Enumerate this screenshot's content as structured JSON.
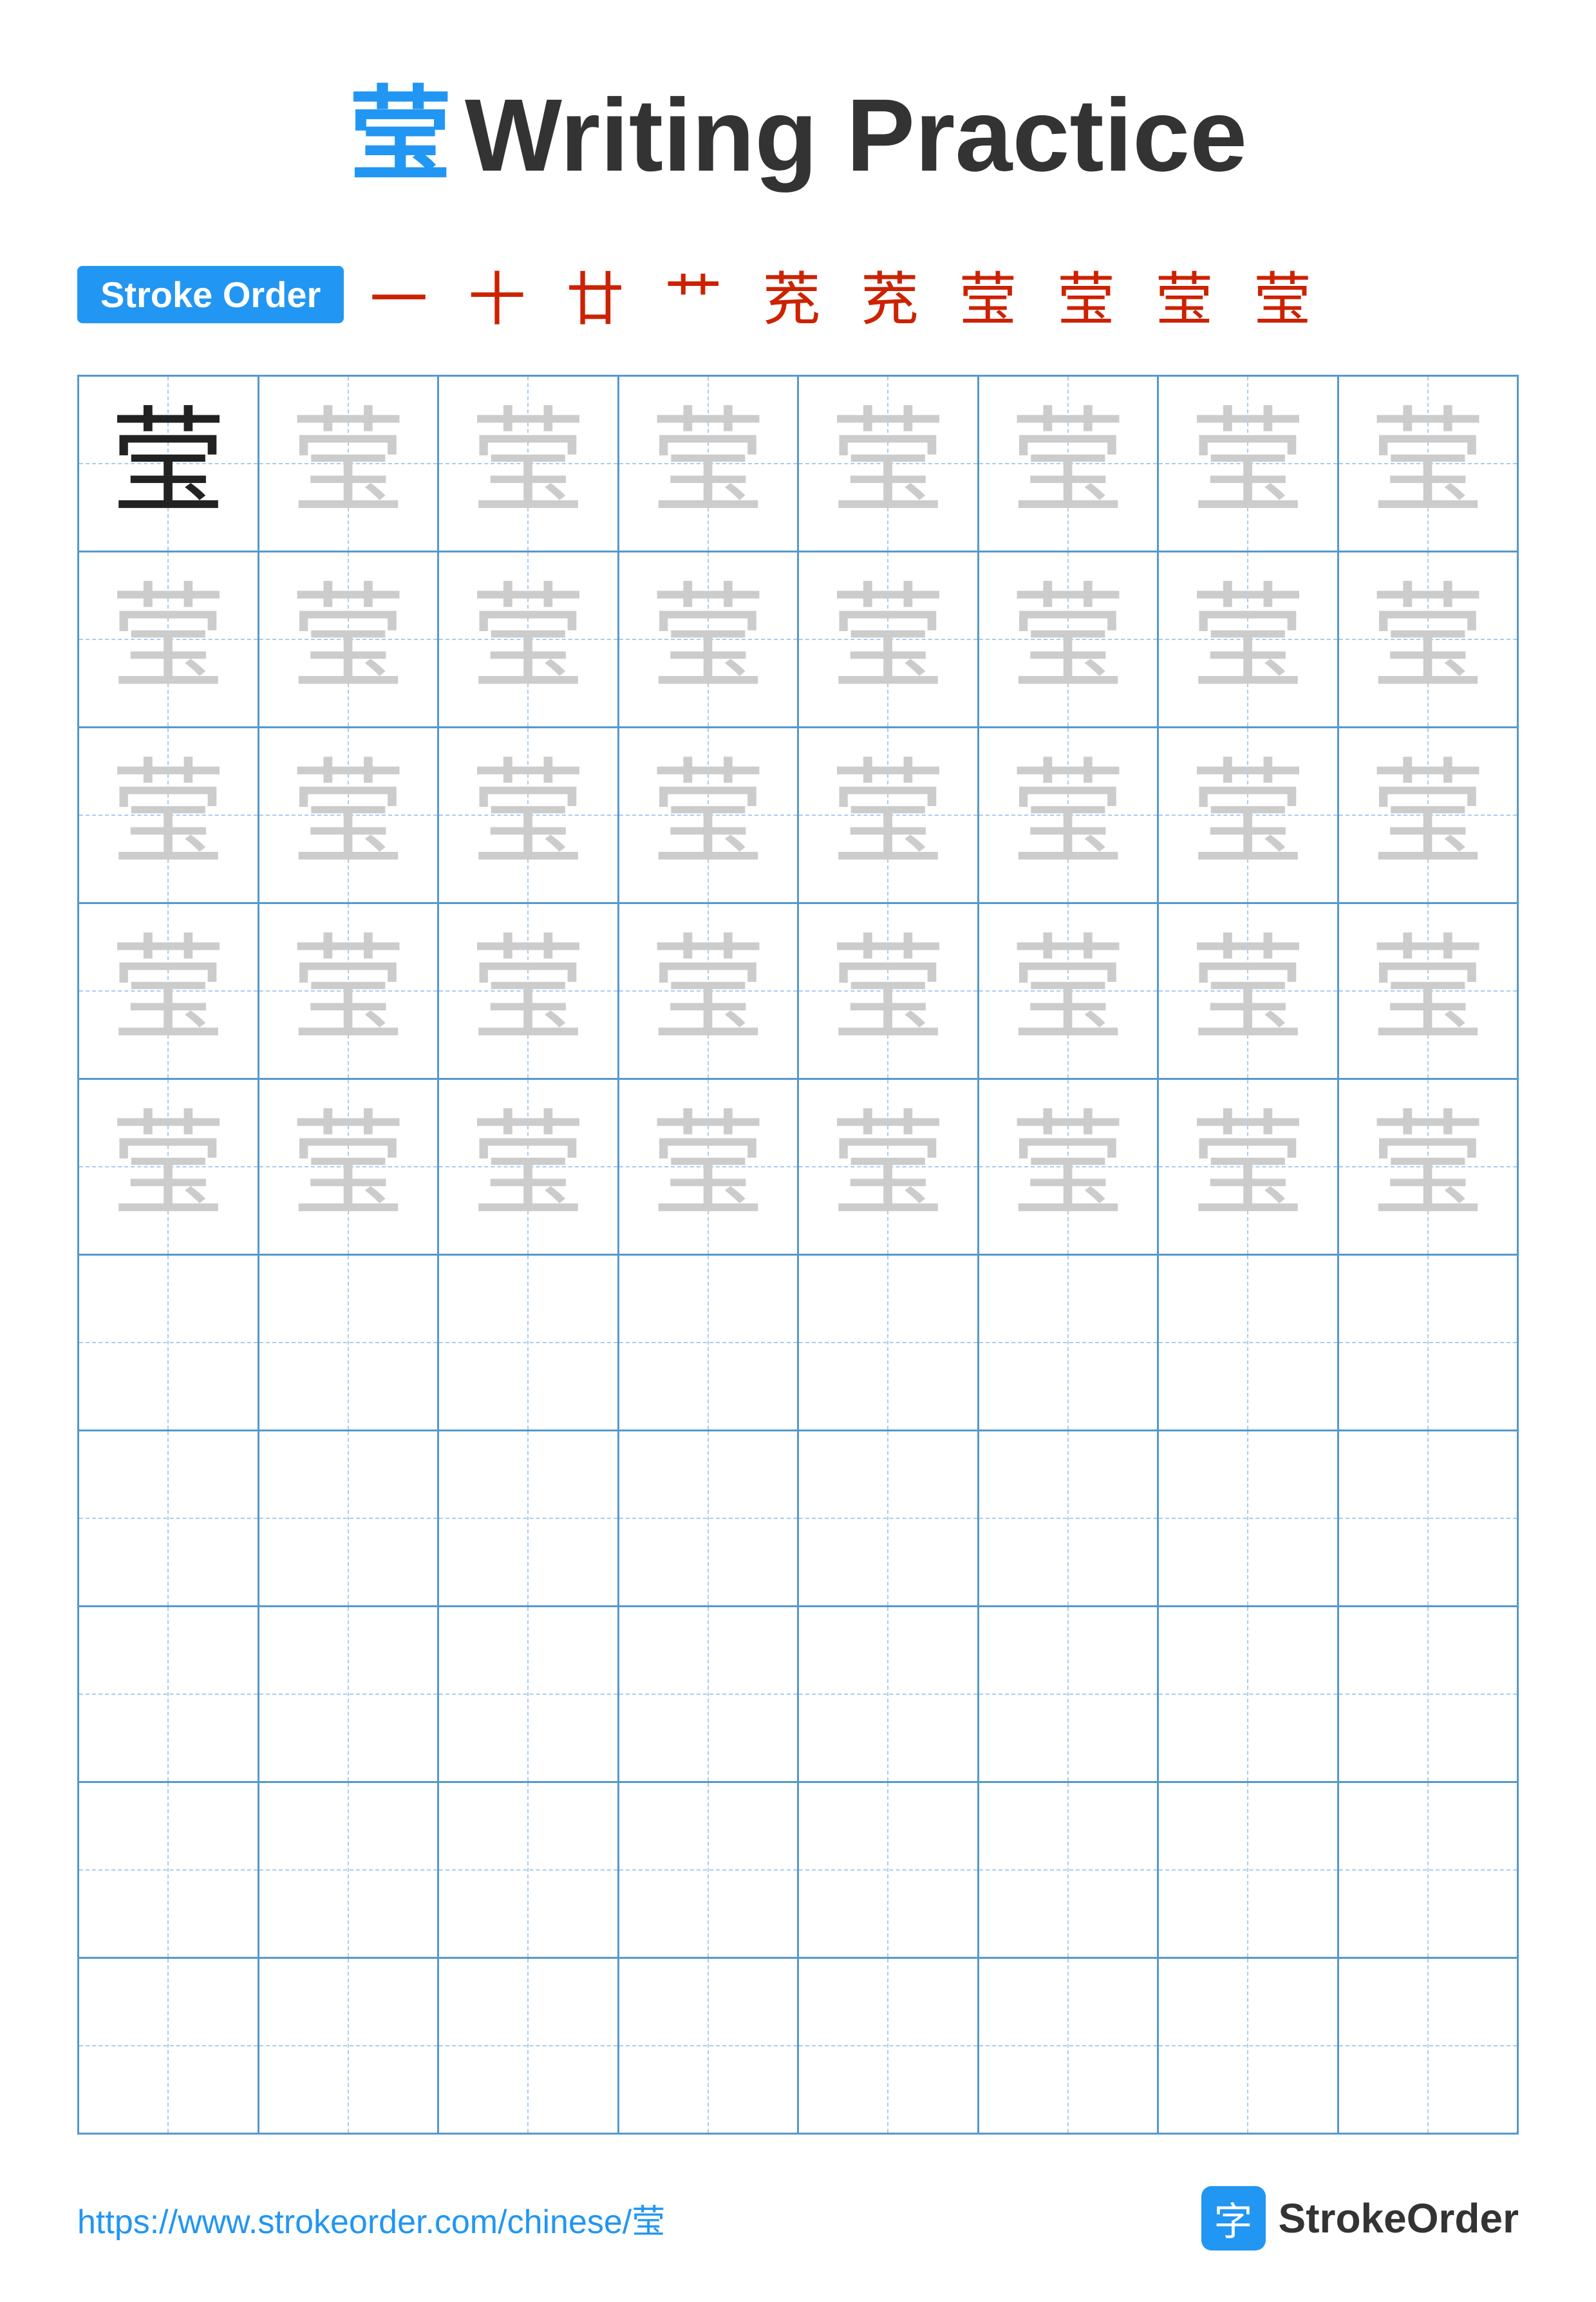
{
  "title": {
    "char": "莹",
    "text": "Writing Practice"
  },
  "stroke_order": {
    "badge_label": "Stroke Order",
    "chars": "一 十 廿 艹 茺 茺 莹 莹 莹 莹"
  },
  "grid": {
    "rows": 10,
    "cols": 8,
    "practice_char": "莹",
    "filled_rows": 5,
    "empty_rows": 5
  },
  "footer": {
    "url": "https://www.strokeorder.com/chinese/莹",
    "logo_char": "字",
    "logo_text": "StrokeOrder"
  }
}
